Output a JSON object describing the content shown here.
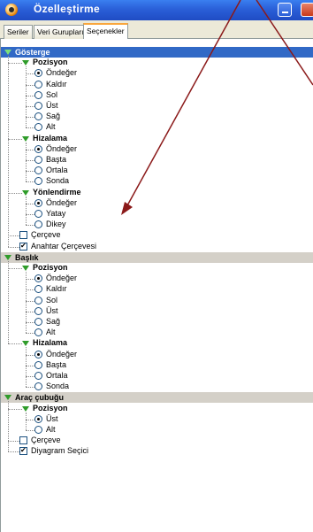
{
  "window": {
    "title": "Özelleştirme"
  },
  "tabs": [
    {
      "label": "Seriler",
      "active": false
    },
    {
      "label": "Veri Gurupları",
      "active": false
    },
    {
      "label": "Seçenekler",
      "active": true
    }
  ],
  "sections": [
    {
      "label": "Gösterge",
      "selected": true,
      "groups": [
        {
          "label": "Pozisyon",
          "options": [
            {
              "label": "Öndeğer",
              "on": true
            },
            {
              "label": "Kaldır",
              "on": false
            },
            {
              "label": "Sol",
              "on": false
            },
            {
              "label": "Üst",
              "on": false
            },
            {
              "label": "Sağ",
              "on": false
            },
            {
              "label": "Alt",
              "on": false
            }
          ]
        },
        {
          "label": "Hizalama",
          "options": [
            {
              "label": "Öndeğer",
              "on": true
            },
            {
              "label": "Başta",
              "on": false
            },
            {
              "label": "Ortala",
              "on": false
            },
            {
              "label": "Sonda",
              "on": false
            }
          ]
        },
        {
          "label": "Yönlendirme",
          "options": [
            {
              "label": "Öndeğer",
              "on": true
            },
            {
              "label": "Yatay",
              "on": false
            },
            {
              "label": "Dikey",
              "on": false
            }
          ]
        }
      ],
      "checks": [
        {
          "label": "Çerçeve",
          "on": false
        },
        {
          "label": "Anahtar Çerçevesi",
          "on": true
        }
      ]
    },
    {
      "label": "Başlık",
      "selected": false,
      "groups": [
        {
          "label": "Pozisyon",
          "options": [
            {
              "label": "Öndeğer",
              "on": true
            },
            {
              "label": "Kaldır",
              "on": false
            },
            {
              "label": "Sol",
              "on": false
            },
            {
              "label": "Üst",
              "on": false
            },
            {
              "label": "Sağ",
              "on": false
            },
            {
              "label": "Alt",
              "on": false
            }
          ]
        },
        {
          "label": "Hizalama",
          "options": [
            {
              "label": "Öndeğer",
              "on": true
            },
            {
              "label": "Başta",
              "on": false
            },
            {
              "label": "Ortala",
              "on": false
            },
            {
              "label": "Sonda",
              "on": false
            }
          ]
        }
      ],
      "checks": []
    },
    {
      "label": "Araç çubuğu",
      "selected": false,
      "groups": [
        {
          "label": "Pozisyon",
          "options": [
            {
              "label": "Üst",
              "on": true
            },
            {
              "label": "Alt",
              "on": false
            }
          ]
        }
      ],
      "checks": [
        {
          "label": "Çerçeve",
          "on": false
        },
        {
          "label": "Diyagram Seçici",
          "on": true
        }
      ]
    }
  ],
  "colors": {
    "selected_row": "#3169c6",
    "section_header": "#d4d0c8",
    "expand_triangle": "#2f9c2a",
    "annotation": "#8b1a1a"
  }
}
